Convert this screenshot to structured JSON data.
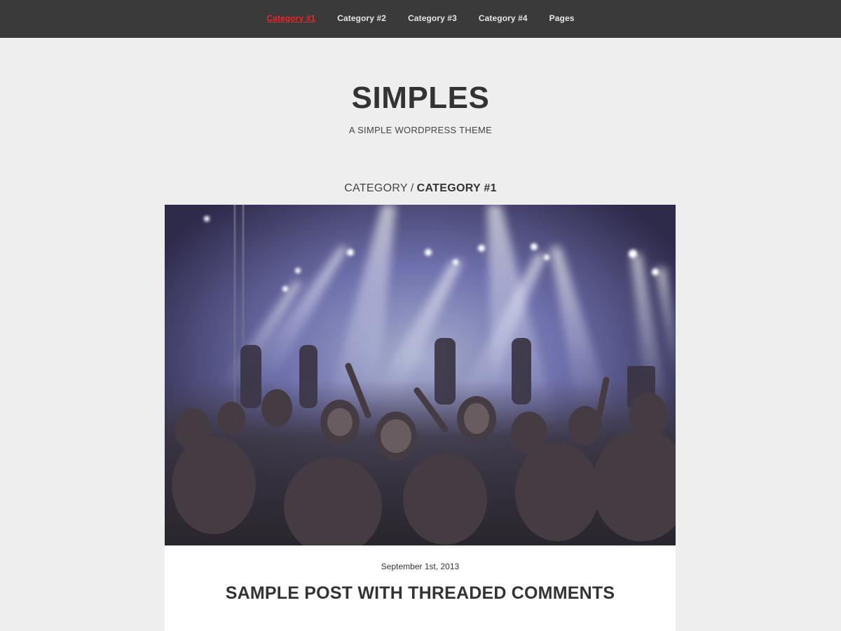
{
  "nav": {
    "items": [
      {
        "label": "Category #1",
        "active": true
      },
      {
        "label": "Category #2",
        "active": false
      },
      {
        "label": "Category #3",
        "active": false
      },
      {
        "label": "Category #4",
        "active": false
      },
      {
        "label": "Pages",
        "active": false
      }
    ]
  },
  "header": {
    "title": "SIMPLES",
    "description": "A SIMPLE WORDPRESS THEME"
  },
  "archive": {
    "prefix": "CATEGORY",
    "separator": "/",
    "term": "CATEGORY #1"
  },
  "post": {
    "image_icon": "concert-crowd-photo",
    "date": "September 1st, 2013",
    "title": "SAMPLE POST WITH THREADED COMMENTS"
  },
  "colors": {
    "nav_bg": "#3a3a3a",
    "nav_active": "#e8262b",
    "page_bg": "#eeeeee",
    "card_bg": "#ffffff",
    "text": "#333333"
  }
}
